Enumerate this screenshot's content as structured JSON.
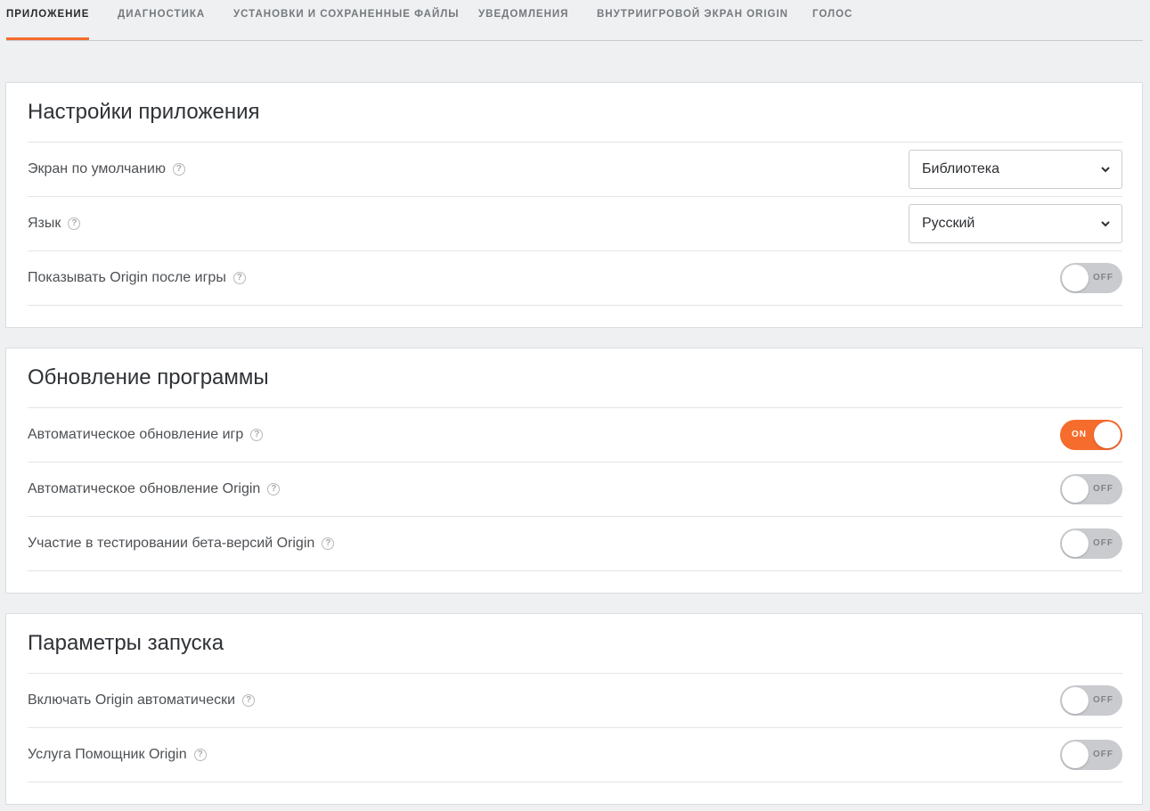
{
  "tabs": [
    {
      "label": "ПРИЛОЖЕНИЕ",
      "active": true
    },
    {
      "label": "ДИАГНОСТИКА"
    },
    {
      "label": "УСТАНОВКИ И СОХРАНЕННЫЕ ФАЙЛЫ"
    },
    {
      "label": "УВЕДОМЛЕНИЯ"
    },
    {
      "label": "ВНУТРИИГРОВОЙ ЭКРАН ORIGIN"
    },
    {
      "label": "ГОЛОС"
    }
  ],
  "help_glyph": "?",
  "colors": {
    "accent": "#f56c2d",
    "toggle_off": "#c9cbcf",
    "background": "#eef0f1"
  },
  "icons": {
    "help": "question-circle-icon",
    "dropdown": "chevron-down-icon"
  },
  "sections": {
    "app": {
      "title": "Настройки приложения",
      "default_screen": {
        "label": "Экран по умолчанию",
        "value": "Библиотека"
      },
      "language": {
        "label": "Язык",
        "value": "Русский"
      },
      "show_after_game": {
        "label": "Показывать Origin после игры",
        "state": "OFF"
      }
    },
    "update": {
      "title": "Обновление программы",
      "auto_update_games": {
        "label": "Автоматическое обновление игр",
        "state": "ON"
      },
      "auto_update_origin": {
        "label": "Автоматическое обновление Origin",
        "state": "OFF"
      },
      "beta": {
        "label": "Участие в тестировании бета-версий Origin",
        "state": "OFF"
      }
    },
    "launch": {
      "title": "Параметры запуска",
      "autostart": {
        "label": "Включать Origin автоматически",
        "state": "OFF"
      },
      "helper": {
        "label": "Услуга Помощник Origin",
        "state": "OFF"
      }
    }
  }
}
